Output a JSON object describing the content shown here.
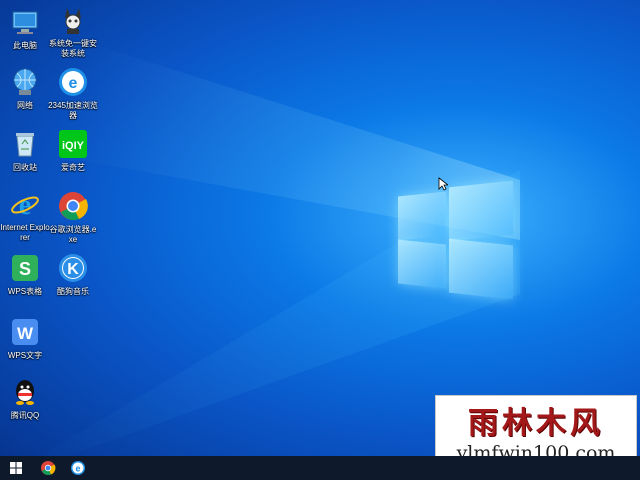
{
  "desktop": {
    "icons": [
      {
        "label": "此电脑",
        "icon": "computer-icon"
      },
      {
        "label": "系统免一键安装系统",
        "icon": "system-install-icon"
      },
      {
        "label": "网络",
        "icon": "network-icon"
      },
      {
        "label": "2345加速浏览器",
        "icon": "browser-2345-icon"
      },
      {
        "label": "回收站",
        "icon": "recycle-bin-icon"
      },
      {
        "label": "爱奇艺",
        "icon": "iqiyi-icon"
      },
      {
        "label": "Internet Explorer",
        "icon": "ie-icon"
      },
      {
        "label": "谷歌浏览器.exe",
        "icon": "chrome-icon"
      },
      {
        "label": "WPS表格",
        "icon": "wps-sheet-icon"
      },
      {
        "label": "酷狗音乐",
        "icon": "kugou-icon"
      },
      {
        "label": "WPS文字",
        "icon": "wps-writer-icon"
      },
      {
        "label": "腾讯QQ",
        "icon": "qq-icon"
      }
    ]
  },
  "iqiyi_glyph": "iQIY",
  "wps_sheet_glyph": "S",
  "wps_writer_glyph": "W",
  "kugou_glyph": "K",
  "taskbar": {
    "items": [
      "start-icon",
      "chrome-icon",
      "ie-icon"
    ]
  },
  "watermark": {
    "title": "雨林木风",
    "url": "ylmfwin100.com"
  },
  "colors": {
    "desktop_blue": "#0a55c7",
    "taskbar": "#0e1a2b",
    "watermark_red": "#a31818"
  }
}
